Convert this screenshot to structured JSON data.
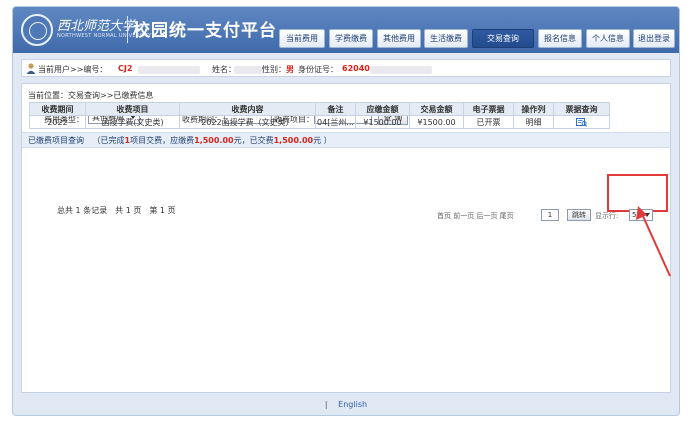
{
  "header": {
    "logo_cn": "西北师范大学",
    "logo_en": "NORTHWEST NORMAL UNIVERSITY",
    "title": "校园统一支付平台",
    "nav": [
      {
        "label": "当前费用",
        "active": false
      },
      {
        "label": "学费缴费",
        "active": false
      },
      {
        "label": "其他费用",
        "active": false
      },
      {
        "label": "生活缴费",
        "active": false
      },
      {
        "label": "交易查询",
        "active": true
      },
      {
        "label": "报名信息",
        "active": false
      },
      {
        "label": "个人信息",
        "active": false
      },
      {
        "label": "退出登录",
        "active": false
      }
    ]
  },
  "userbar": {
    "current_user_label": "当前用户>>编号：",
    "user_id": "CJ2",
    "name_label": "姓名：",
    "gender_label": "性别：",
    "gender": "男",
    "idcard_label": "身份证号：",
    "idcard": "62040"
  },
  "breadcrumb": "当前位置：交易查询>>已缴费信息",
  "filters": {
    "fee_type_label": "费用类型：",
    "fee_type_value": "其他费用",
    "period_label": "收费期间：",
    "item_label": "收费项目：",
    "query_button": "查 询"
  },
  "section": {
    "title": "已缴费项目查询",
    "summary_prefix": "（已完成",
    "count": "1",
    "summary_mid1": "项目交费，应缴费",
    "due": "1,500.00",
    "summary_mid2": "元，已交费",
    "paid": "1,500.00",
    "summary_suffix": "元 ）"
  },
  "table": {
    "headers": [
      "收费期间",
      "收费项目",
      "收费内容",
      "备注",
      "应缴金额",
      "交易金额",
      "电子票据",
      "操作列",
      "票据查询"
    ],
    "rows": [
      {
        "period": "2022",
        "item": "函授学费(文史类)",
        "content": "2022函授学费（文史类）",
        "note": "04[兰州...",
        "due": "¥1500.00",
        "paid": "¥1500.00",
        "e_receipt": "已开票",
        "action": "明细"
      }
    ]
  },
  "pager": {
    "summary": "总共 1 条记录　共 1 页　第 1 页",
    "nav_text": "首页 前一页 后一页 尾页",
    "page_value": "1",
    "jump_button": "跳转",
    "pagesize_label": "显示行:",
    "pagesize_value": "5"
  },
  "footer": {
    "separator": "|",
    "english_link": "English"
  },
  "colors": {
    "header_blue": "#4a73b4",
    "nav_active": "#2f5aa0",
    "highlight_red": "#e23a3a",
    "amount_red": "#d4241b",
    "receipt_green": "#2e9a2e"
  }
}
